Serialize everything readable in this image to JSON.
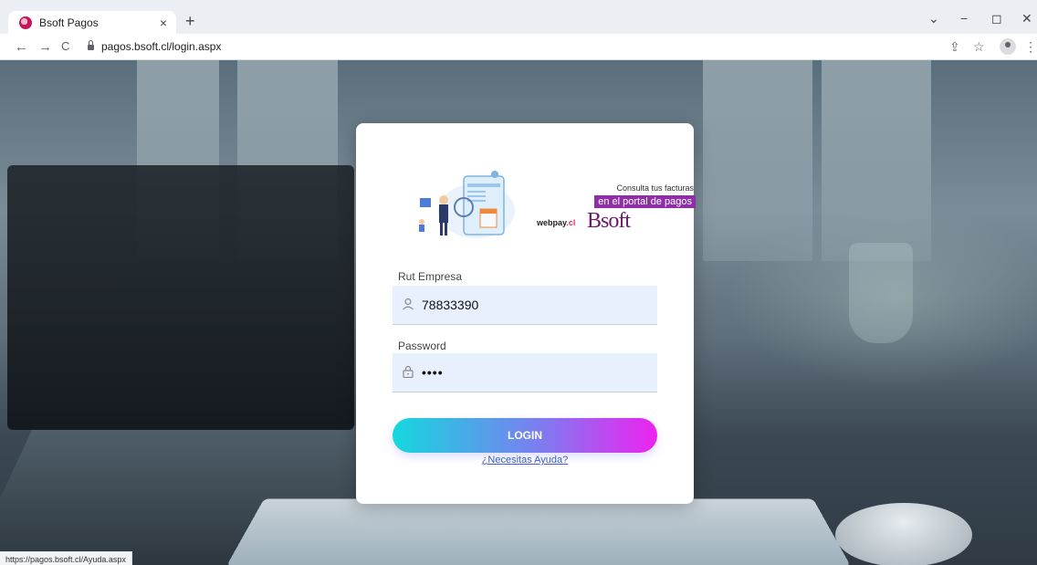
{
  "browser": {
    "tab_title": "Bsoft Pagos",
    "tab_close": "×",
    "new_tab": "+",
    "url": "pagos.bsoft.cl/login.aspx",
    "back": "←",
    "forward": "→",
    "reload": "C",
    "share_icon": "⇪",
    "star_icon": "☆",
    "menu_icon": "⋮",
    "minimize": "−",
    "maximize": "◻",
    "close": "✕",
    "chevron": "⌄"
  },
  "banner": {
    "tagline_small": "Consulta tus facturas",
    "tagline_pill": "en el portal de pagos",
    "webpay_a": "webpay",
    "webpay_b": ".cl",
    "bsoft": "Bsoft"
  },
  "form": {
    "rut_label": "Rut Empresa",
    "rut_value": "78833390",
    "password_label": "Password",
    "password_value": "••••",
    "login_label": "LOGIN",
    "help_label": "¿Necesitas Ayuda?"
  },
  "status": {
    "hover_url": "https://pagos.bsoft.cl/Ayuda.aspx"
  }
}
